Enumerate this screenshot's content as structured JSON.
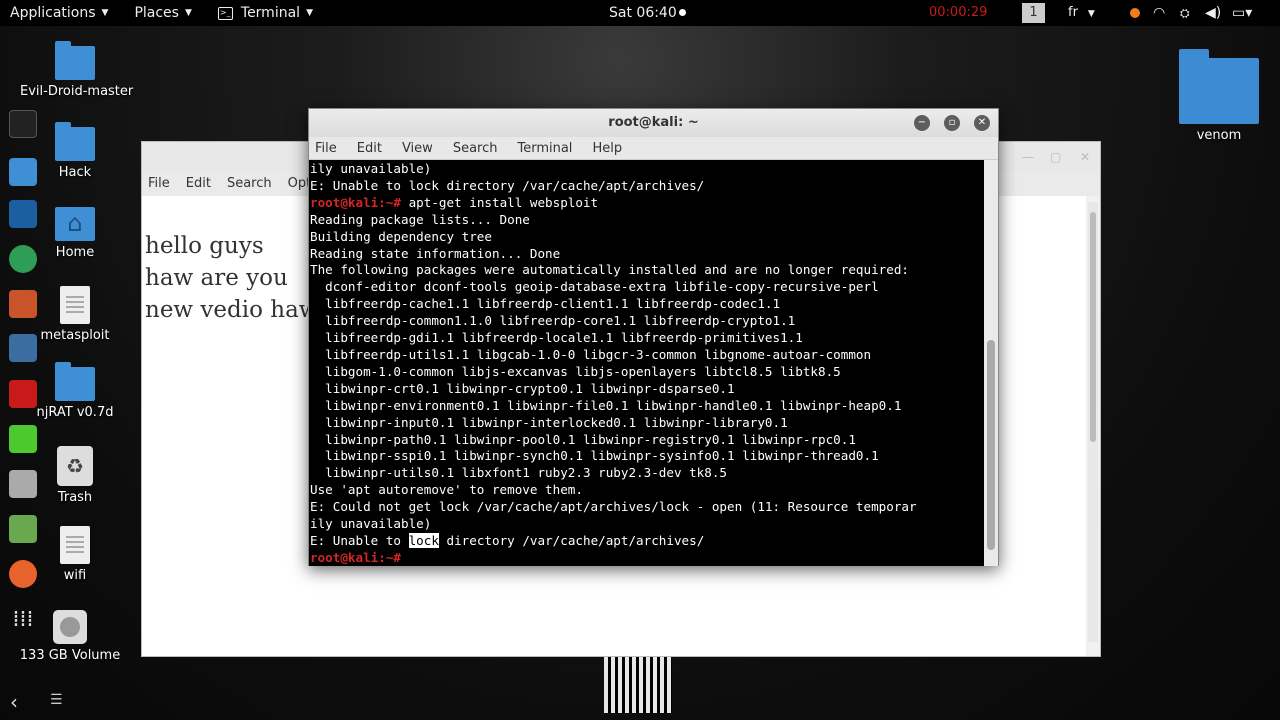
{
  "top_panel": {
    "applications": "Applications",
    "places": "Places",
    "terminal": "Terminal",
    "clock": "Sat 06:40",
    "rec_timer": "00:00:29",
    "workspace": "1",
    "lang": "fr",
    "tray_icons": [
      "record-dot-icon",
      "wifi-icon",
      "volume-icon",
      "battery-icon"
    ]
  },
  "desktop": {
    "icons": [
      {
        "label": "Evil-Droid-master",
        "type": "folder"
      },
      {
        "label": "Hack",
        "type": "folder"
      },
      {
        "label": "Home",
        "type": "home"
      },
      {
        "label": "metasploit",
        "type": "doc"
      },
      {
        "label": "njRAT v0.7d",
        "type": "folder"
      },
      {
        "label": "Trash",
        "type": "trash"
      },
      {
        "label": "wifi",
        "type": "doc"
      },
      {
        "label": "133 GB Volume",
        "type": "drive"
      },
      {
        "label": "venom",
        "type": "folder"
      }
    ]
  },
  "gedit": {
    "menu": [
      "File",
      "Edit",
      "Search",
      "Optio"
    ],
    "text": "hello guys\nhaw are you\nnew vedio haw t"
  },
  "terminal": {
    "title": "root@kali: ~",
    "menu": [
      "File",
      "Edit",
      "View",
      "Search",
      "Terminal",
      "Help"
    ],
    "prompt": "root@kali:~#",
    "lines": [
      "ily unavailable)",
      "E: Unable to lock directory /var/cache/apt/archives/",
      "__PROMPT__ apt-get install websploit",
      "Reading package lists... Done",
      "Building dependency tree",
      "Reading state information... Done",
      "The following packages were automatically installed and are no longer required:",
      "  dconf-editor dconf-tools geoip-database-extra libfile-copy-recursive-perl",
      "  libfreerdp-cache1.1 libfreerdp-client1.1 libfreerdp-codec1.1",
      "  libfreerdp-common1.1.0 libfreerdp-core1.1 libfreerdp-crypto1.1",
      "  libfreerdp-gdi1.1 libfreerdp-locale1.1 libfreerdp-primitives1.1",
      "  libfreerdp-utils1.1 libgcab-1.0-0 libgcr-3-common libgnome-autoar-common",
      "  libgom-1.0-common libjs-excanvas libjs-openlayers libtcl8.5 libtk8.5",
      "  libwinpr-crt0.1 libwinpr-crypto0.1 libwinpr-dsparse0.1",
      "  libwinpr-environment0.1 libwinpr-file0.1 libwinpr-handle0.1 libwinpr-heap0.1",
      "  libwinpr-input0.1 libwinpr-interlocked0.1 libwinpr-library0.1",
      "  libwinpr-path0.1 libwinpr-pool0.1 libwinpr-registry0.1 libwinpr-rpc0.1",
      "  libwinpr-sspi0.1 libwinpr-synch0.1 libwinpr-sysinfo0.1 libwinpr-thread0.1",
      "  libwinpr-utils0.1 libxfont1 ruby2.3 ruby2.3-dev tk8.5",
      "Use 'apt autoremove' to remove them.",
      "E: Could not get lock /var/cache/apt/archives/lock - open (11: Resource temporar",
      "ily unavailable)",
      "__SEL__E: Unable to |lock| directory /var/cache/apt/archives/",
      "__PROMPT__ "
    ]
  }
}
